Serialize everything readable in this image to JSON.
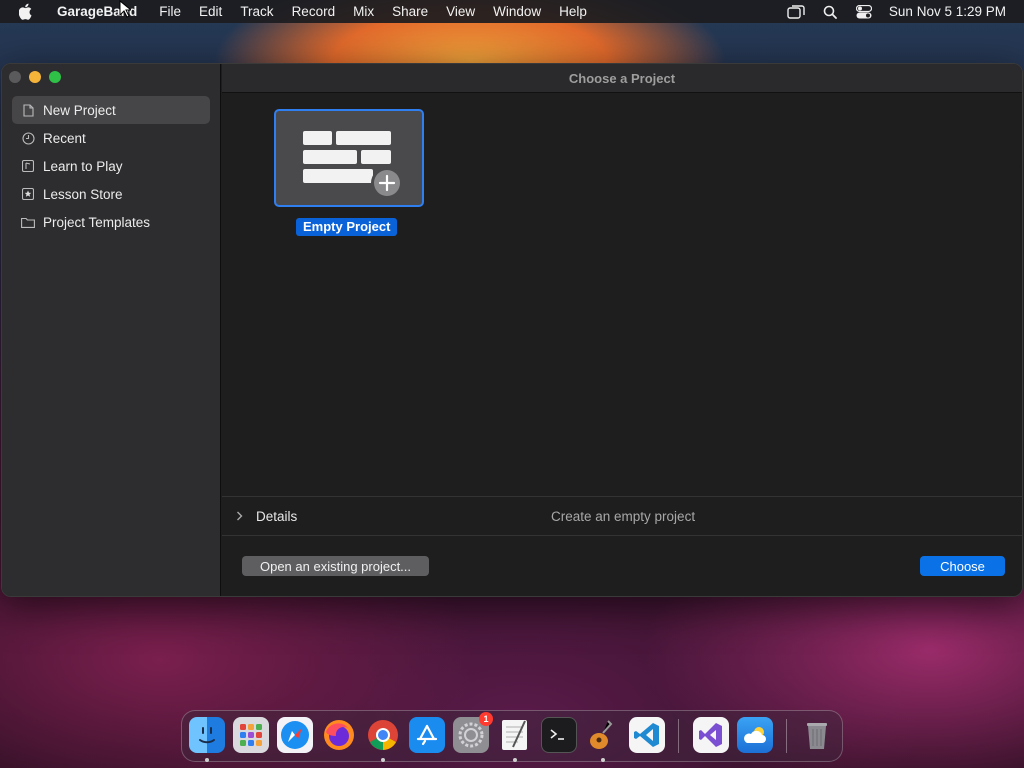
{
  "menubar": {
    "app_name": "GarageBand",
    "items": [
      "File",
      "Edit",
      "Track",
      "Record",
      "Mix",
      "Share",
      "View",
      "Window",
      "Help"
    ],
    "clock": "Sun Nov 5  1:29 PM",
    "status_icons": [
      "screen-mirroring-icon",
      "spotlight-search-icon",
      "control-center-icon"
    ]
  },
  "window": {
    "title": "Choose a Project",
    "sidebar": {
      "items": [
        {
          "label": "New Project",
          "icon": "document-icon",
          "selected": true
        },
        {
          "label": "Recent",
          "icon": "clock-icon",
          "selected": false
        },
        {
          "label": "Learn to Play",
          "icon": "lesson-icon",
          "selected": false
        },
        {
          "label": "Lesson Store",
          "icon": "star-box-icon",
          "selected": false
        },
        {
          "label": "Project Templates",
          "icon": "folder-icon",
          "selected": false
        }
      ]
    },
    "project": {
      "caption": "Empty Project",
      "icon": "empty-project-plus-icon"
    },
    "details": {
      "label": "Details",
      "description": "Create an empty project"
    },
    "buttons": {
      "open_existing": "Open an existing project...",
      "choose": "Choose"
    }
  },
  "dock": {
    "apps": [
      {
        "name": "Finder",
        "icon": "finder-icon"
      },
      {
        "name": "Launchpad",
        "icon": "launchpad-icon"
      },
      {
        "name": "Safari",
        "icon": "safari-icon"
      },
      {
        "name": "Firefox",
        "icon": "firefox-icon"
      },
      {
        "name": "Chrome",
        "icon": "chrome-icon"
      },
      {
        "name": "App Store",
        "icon": "app-store-icon"
      },
      {
        "name": "System Settings",
        "icon": "system-settings-icon",
        "badge": "1"
      },
      {
        "name": "TextEdit",
        "icon": "textedit-icon"
      },
      {
        "name": "Terminal",
        "icon": "terminal-icon"
      },
      {
        "name": "GarageBand",
        "icon": "garageband-icon"
      },
      {
        "name": "Visual Studio Code",
        "icon": "vscode-icon"
      },
      {
        "name": "Visual Studio",
        "icon": "visual-studio-icon"
      },
      {
        "name": "Weather",
        "icon": "weather-icon"
      },
      {
        "name": "Trash",
        "icon": "trash-icon"
      }
    ]
  },
  "colors": {
    "accent": "#0a72e6",
    "selection": "#0a62d8",
    "traffic_close": "#5a5a5c",
    "traffic_minimize": "#f4b43a",
    "traffic_maximize": "#2fc048"
  }
}
